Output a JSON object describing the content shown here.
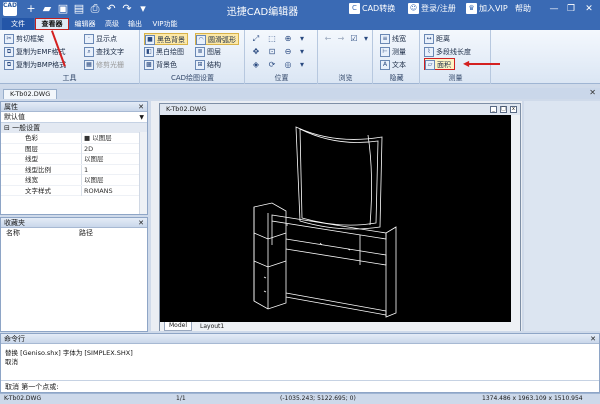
{
  "app": {
    "logo": "CAD",
    "title": "迅捷CAD编辑器",
    "cad_convert": "CAD转换",
    "login": "登录/注册",
    "vip": "加入VIP",
    "help": "帮助"
  },
  "menu": {
    "items": [
      "文件",
      "查看器",
      "编辑器",
      "高级",
      "输出",
      "VIP功能"
    ]
  },
  "ribbon": {
    "tools": {
      "title": "工具",
      "items": [
        "剪切框架",
        "复制为EMF格式",
        "复制为BMP格式",
        "显示点",
        "查找文字",
        "修剪光栅"
      ]
    },
    "cad_settings": {
      "title": "CAD绘图设置",
      "items": [
        "黑色背景",
        "黑白绘图",
        "背景色",
        "圆滑弧形",
        "图层",
        "结构"
      ]
    },
    "position": {
      "title": "位置"
    },
    "browse": {
      "title": "浏览"
    },
    "hide": {
      "title": "隐藏",
      "items": [
        "线宽",
        "测量",
        "文本"
      ]
    },
    "measure": {
      "title": "测量",
      "items": [
        "距离",
        "多段线长度",
        "面积"
      ]
    }
  },
  "document": {
    "tab": "K-Tb02.DWG",
    "window_title": "K-Tb02.DWG",
    "layout_tabs": [
      "Model",
      "Layout1"
    ]
  },
  "properties": {
    "title": "属性",
    "default": "默认值",
    "section": "一般设置",
    "rows": [
      {
        "key": "色彩",
        "value": "■ 以图层"
      },
      {
        "key": "图层",
        "value": "2D"
      },
      {
        "key": "线型",
        "value": "以图层"
      },
      {
        "key": "线型比例",
        "value": "1"
      },
      {
        "key": "线宽",
        "value": "以图层"
      },
      {
        "key": "文字样式",
        "value": "ROMANS"
      }
    ]
  },
  "favorites": {
    "title": "收藏夹",
    "col_name": "名称",
    "col_path": "路径"
  },
  "command": {
    "title": "命令行",
    "lines": [
      "替换 [Geniso.shx] 字体为 [SIMPLEX.SHX]",
      "取消"
    ],
    "prompt": "取消   第一个点或:"
  },
  "status": {
    "file": "K-Tb02.DWG",
    "page": "1/1",
    "coords": "(-1035.243; 5122.695; 0)",
    "size": "1374.486 x 1963.109 x 1510.954"
  }
}
